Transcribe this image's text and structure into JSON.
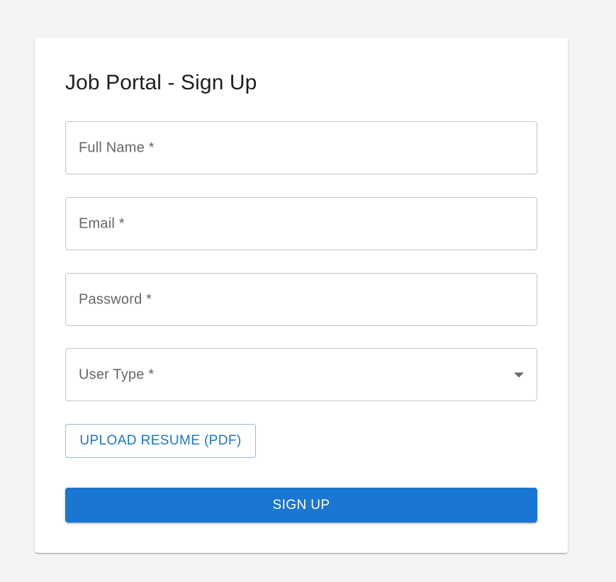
{
  "form": {
    "title": "Job Portal - Sign Up",
    "fields": [
      {
        "label": "Full Name *",
        "value": ""
      },
      {
        "label": "Email *",
        "value": ""
      },
      {
        "label": "Password *",
        "value": ""
      },
      {
        "label": "User Type *",
        "value": ""
      }
    ],
    "upload_label": "UPLOAD RESUME (PDF)",
    "submit_label": "SIGN UP"
  },
  "colors": {
    "primary": "#1976d2",
    "background": "#f4f4f4",
    "card": "#ffffff",
    "field_border": "#c4c4c4",
    "label_text": "#666666"
  },
  "icons": {
    "select_arrow": "chevron-down-icon"
  }
}
